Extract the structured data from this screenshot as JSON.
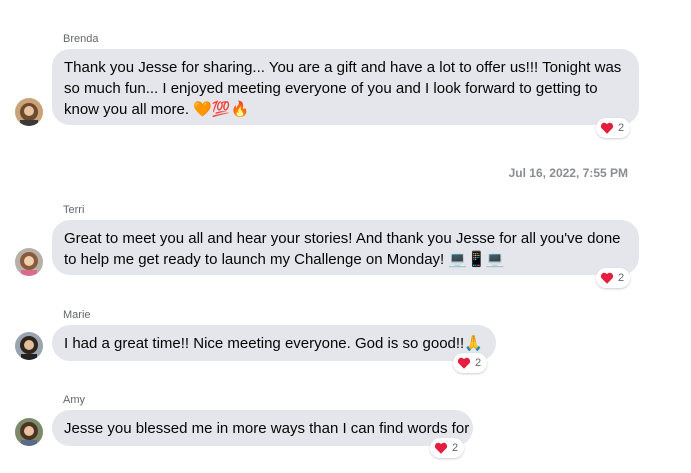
{
  "messages": [
    {
      "sender": "Brenda",
      "lines": [
        "Thank you Jesse for sharing... You are a gift and have a lot to offer us!!! Tonight was",
        "so much fun... I enjoyed meeting everyone of you and I look forward to getting to",
        "know you all more. 🧡💯🔥"
      ],
      "reaction_icon": "red-heart-icon",
      "reaction_count": "2"
    },
    {
      "sender": "Terri",
      "lines": [
        "Great to meet you all and hear your stories! And thank you Jesse for all you've done",
        "to help me get ready to launch my Challenge on Monday! 💻📱💻"
      ],
      "reaction_icon": "red-heart-icon",
      "reaction_count": "2"
    },
    {
      "sender": "Marie",
      "lines": [
        "I had a great time!! Nice meeting everyone.  God is so good!!🙏"
      ],
      "reaction_icon": "red-heart-icon",
      "reaction_count": "2"
    },
    {
      "sender": "Amy",
      "lines": [
        "Jesse you blessed me in more ways than I can find words for"
      ],
      "reaction_icon": "red-heart-icon",
      "reaction_count": "2"
    }
  ],
  "timestamp": "Jul 16, 2022, 7:55 PM",
  "colors": {
    "bubble": "#e4e6eb",
    "heart": "#e41e3f",
    "meta_text": "#65676b"
  }
}
